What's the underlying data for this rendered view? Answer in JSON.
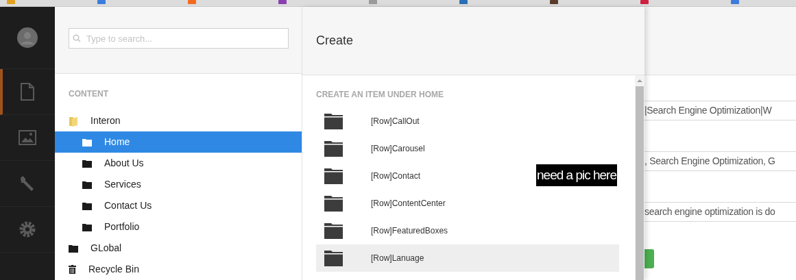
{
  "nav": [
    {
      "kind": "avatar",
      "active": false
    },
    {
      "kind": "document",
      "active": true
    },
    {
      "kind": "image",
      "active": false
    },
    {
      "kind": "wrench",
      "active": false
    },
    {
      "kind": "gear",
      "active": false
    }
  ],
  "tree_panel": {
    "search": {
      "placeholder": "Type to search..."
    },
    "section_title": "CONTENT",
    "tree": [
      {
        "label": "Interon",
        "kind": "folder-open",
        "selected": false,
        "children": [
          {
            "label": "Home",
            "kind": "folder",
            "selected": true
          },
          {
            "label": "About Us",
            "kind": "folder",
            "selected": false
          },
          {
            "label": "Services",
            "kind": "folder",
            "selected": false
          },
          {
            "label": "Contact Us",
            "kind": "folder",
            "selected": false
          },
          {
            "label": "Portfolio",
            "kind": "folder",
            "selected": false
          }
        ]
      },
      {
        "label": "GLobal",
        "kind": "folder",
        "selected": false
      },
      {
        "label": "Recycle Bin",
        "kind": "trash",
        "selected": false
      }
    ]
  },
  "create_panel": {
    "title": "Create",
    "subtitle": "CREATE AN ITEM UNDER HOME",
    "items": [
      {
        "label": "[Row]CallOut",
        "highlighted": false
      },
      {
        "label": "[Row]Carousel",
        "highlighted": false
      },
      {
        "label": "[Row]Contact",
        "highlighted": false
      },
      {
        "label": "[Row]ContentCenter",
        "highlighted": false
      },
      {
        "label": "[Row]FeaturedBoxes",
        "highlighted": false
      },
      {
        "label": "[Row]Lanuage",
        "highlighted": true
      }
    ],
    "annotation": "need a pic here"
  },
  "background_fields": [
    "|Search Engine Optimization|W",
    ", Search Engine Optimization, G",
    "search engine optimization is do"
  ]
}
